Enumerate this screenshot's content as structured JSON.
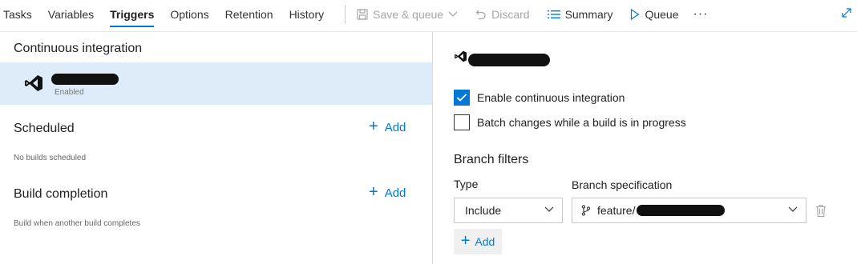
{
  "toolbar": {
    "tabs": [
      "Tasks",
      "Variables",
      "Triggers",
      "Options",
      "Retention",
      "History"
    ],
    "active_tab": "Triggers",
    "save_queue_label": "Save & queue",
    "discard_label": "Discard",
    "summary_label": "Summary",
    "queue_label": "Queue",
    "more_label": "···"
  },
  "left": {
    "ci_title": "Continuous integration",
    "ci_item_status": "Enabled",
    "scheduled_title": "Scheduled",
    "scheduled_add": "Add",
    "scheduled_note": "No builds scheduled",
    "completion_title": "Build completion",
    "completion_add": "Add",
    "completion_note": "Build when another build completes"
  },
  "right": {
    "enable_ci_label": "Enable continuous integration",
    "enable_ci_checked": true,
    "batch_label": "Batch changes while a build is in progress",
    "batch_checked": false,
    "branch_filters_title": "Branch filters",
    "type_label": "Type",
    "branch_spec_label": "Branch specification",
    "type_value": "Include",
    "branch_spec_prefix": "feature/",
    "add_label": "Add"
  },
  "colors": {
    "accent": "#0078d4",
    "selected_bg": "#deecf9"
  }
}
